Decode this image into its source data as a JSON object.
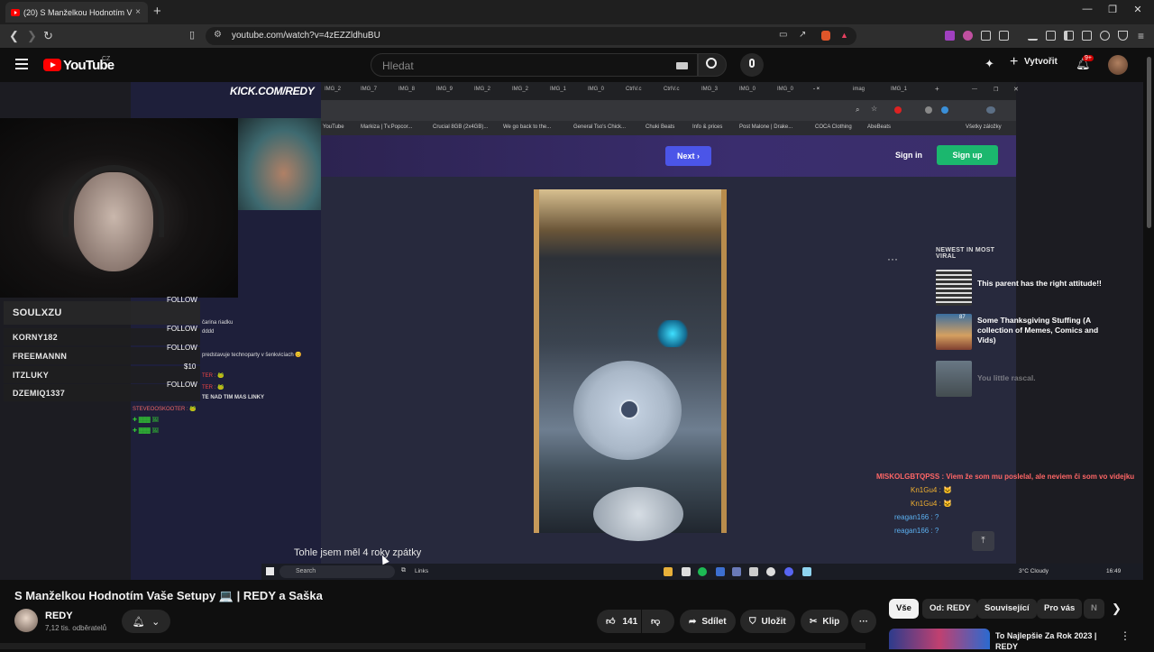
{
  "browser": {
    "tab_title": "(20) S Manželkou Hodnotím V",
    "url": "youtube.com/watch?v=4zEZZldhuBU",
    "new_tab": "+",
    "min": "—",
    "max": "❐",
    "close": "✕"
  },
  "youtube": {
    "logo_text": "YouTube",
    "country": "CZ",
    "search_placeholder": "Hledat",
    "create_label": "Vytvořit",
    "notif_count": "9+"
  },
  "stream": {
    "kick_logo": "KICK.COM/REDY",
    "follow_rows": [
      {
        "name": "SOULXZU",
        "label": "FOLLOW"
      },
      {
        "name": "KORNY182",
        "label": "FOLLOW"
      },
      {
        "name": "FREEMANNN",
        "label": "FOLLOW"
      },
      {
        "name": "ITZLUKY",
        "label": "$10"
      },
      {
        "name": "DZEMIQ1337",
        "label": "FOLLOW"
      }
    ],
    "chat_left": [
      "čarina riadku",
      "dddd",
      "predstavuje technoparty v šenkvicíach 😊",
      "TER : 🐸",
      "TER : 🐸",
      "TE NAD TIM MAS LINKY",
      "STEVEOOSKOOTER : 🐸"
    ],
    "chat_right": [
      "MISKOLGBTQPSS : Viem že som mu poslelal, ale neviem či som vo videjku",
      "Kn1Gu4 : 🐱",
      "Kn1Gu4 : 🐱",
      "reagan166 : ?",
      "reagan166 : ?"
    ],
    "scroll_top": "⤒"
  },
  "capture": {
    "tabs": [
      "IMG_2",
      "IMG_7",
      "IMG_8",
      "IMG_9",
      "IMG_2",
      "IMG_2",
      "IMG_1",
      "IMG_0",
      "CtrlV.c",
      "CtrlV.c",
      "IMG_3",
      "IMG_0",
      "IMG_0",
      "- ×",
      "imag",
      "IMG_1"
    ],
    "bookmarks": [
      "YouTube",
      "Markiza | Tv.Popcor...",
      "Crucial 8GB (2x4GB)...",
      "We go back to the...",
      "General Tso's Chick...",
      "Chuki Beats",
      "Info & prices",
      "Post Malone | Drake...",
      "COCA Clothing",
      "AbeBeats",
      "Všetky záložky"
    ],
    "next_label": "Next",
    "signin_label": "Sign in",
    "signup_label": "Sign up",
    "dots": "···",
    "caption": "Tohle jsem měl 4 roky zpátky",
    "viral_heading": "NEWEST IN MOST VIRAL",
    "viral_items": [
      {
        "title": "This parent has the right attitude!!"
      },
      {
        "title": "Some Thanksgiving Stuffing (A collection of Memes, Comics and Vids)",
        "badge": "87"
      },
      {
        "title": "You little rascal."
      }
    ],
    "taskbar_search": "Search",
    "taskbar_links": "Links",
    "weather": "3°C  Cloudy",
    "clock": "16:49"
  },
  "video": {
    "title": "S Manželkou Hodnotím Vaše Setupy 💻 | REDY a Saška",
    "channel": "REDY",
    "subscribers": "7,12 tis. odběratelů",
    "likes": "141",
    "share": "Sdílet",
    "save": "Uložit",
    "clip": "Klip",
    "more": "···"
  },
  "chips": [
    "Vše",
    "Od: REDY",
    "Související",
    "Pro vás",
    "N"
  ],
  "recommended": {
    "title": "To Najlepšie Za Rok 2023 | REDY"
  },
  "colors": {
    "yt_red": "#ff0000",
    "imgur_next": "#4b55e8",
    "imgur_signup": "#1bb76e"
  }
}
